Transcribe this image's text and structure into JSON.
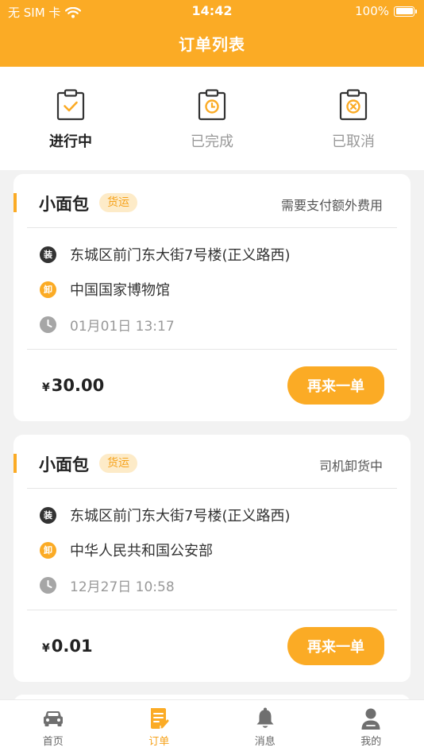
{
  "status_bar": {
    "carrier": "无 SIM 卡",
    "time": "14:42",
    "battery": "100%"
  },
  "header": {
    "title": "订单列表"
  },
  "tabs": [
    {
      "label": "进行中",
      "icon": "clipboard-check-icon",
      "active": true
    },
    {
      "label": "已完成",
      "icon": "clipboard-clock-icon",
      "active": false
    },
    {
      "label": "已取消",
      "icon": "clipboard-cancel-icon",
      "active": false
    }
  ],
  "orders": [
    {
      "vehicle": "小面包",
      "tag": "货运",
      "status": "需要支付额外费用",
      "load_badge": "装",
      "load_address": "东城区前门东大街7号楼(正义路西)",
      "unload_badge": "卸",
      "unload_address": "中国国家博物馆",
      "time": "01月01日 13:17",
      "currency": "¥",
      "price": "30.00",
      "button": "再来一单"
    },
    {
      "vehicle": "小面包",
      "tag": "货运",
      "status": "司机卸货中",
      "load_badge": "装",
      "load_address": "东城区前门东大街7号楼(正义路西)",
      "unload_badge": "卸",
      "unload_address": "中华人民共和国公安部",
      "time": "12月27日 10:58",
      "currency": "¥",
      "price": "0.01",
      "button": "再来一单"
    }
  ],
  "bottom_nav": [
    {
      "label": "首页",
      "icon": "car-icon",
      "active": false
    },
    {
      "label": "订单",
      "icon": "order-icon",
      "active": true
    },
    {
      "label": "消息",
      "icon": "bell-icon",
      "active": false
    },
    {
      "label": "我的",
      "icon": "user-icon",
      "active": false
    }
  ],
  "colors": {
    "accent": "#fbab25",
    "tag_bg": "#fdebc8",
    "inactive": "#999999"
  }
}
